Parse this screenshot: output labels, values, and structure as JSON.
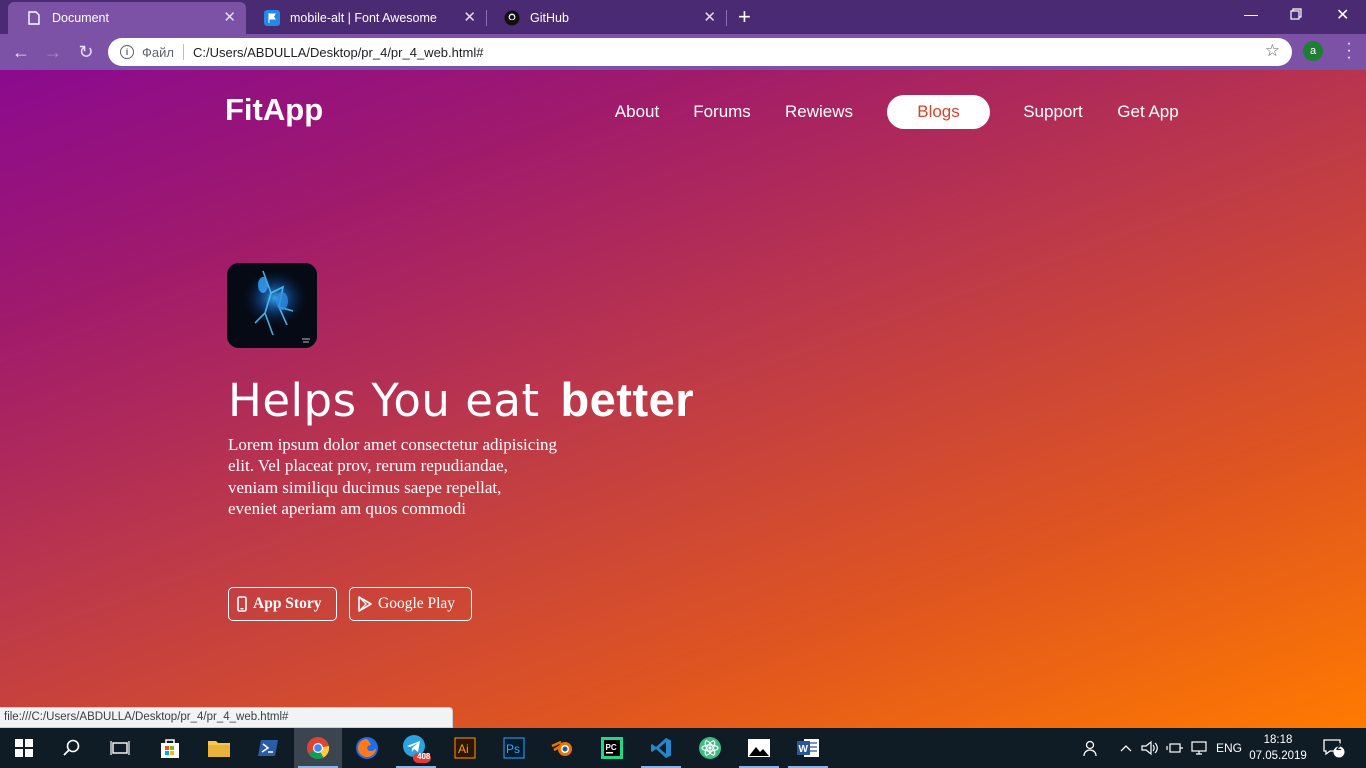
{
  "browser": {
    "tabs": [
      {
        "title": "Document",
        "icon": "document-icon"
      },
      {
        "title": "mobile-alt | Font Awesome",
        "icon": "font-awesome-flag-icon"
      },
      {
        "title": "GitHub",
        "icon": "github-icon"
      }
    ],
    "address_scheme": "Файл",
    "address_url": "C:/Users/ABDULLA/Desktop/pr_4/pr_4_web.html#",
    "profile_initial": "a",
    "status_url": "file:///C:/Users/ABDULLA/Desktop/pr_4/pr_4_web.html#"
  },
  "site": {
    "logo": "FitApp",
    "nav": [
      "About",
      "Forums",
      "Rewiews",
      "Blogs",
      "Support",
      "Get App"
    ],
    "active_nav": "Blogs",
    "headline_light": "Helps You eat",
    "headline_bold": "better",
    "paragraph_lines": [
      "Lorem ipsum dolor amet consectetur adipisicing",
      "elit. Vel placeat prov, rerum repudiandae,",
      "veniam similiqu ducimus saepe repellat,",
      "eveniet aperiam am quos commodi"
    ],
    "buttons": {
      "app_store": "App Story",
      "google_play": "Google Play"
    },
    "colors": {
      "gradient_start": "#8b0a8f",
      "gradient_end": "#ff7a00",
      "active_nav_text": "#d4452a"
    }
  },
  "taskbar": {
    "badge_count": "408",
    "language": "ENG",
    "time": "18:18",
    "date": "07.05.2019",
    "notifications": "2"
  }
}
